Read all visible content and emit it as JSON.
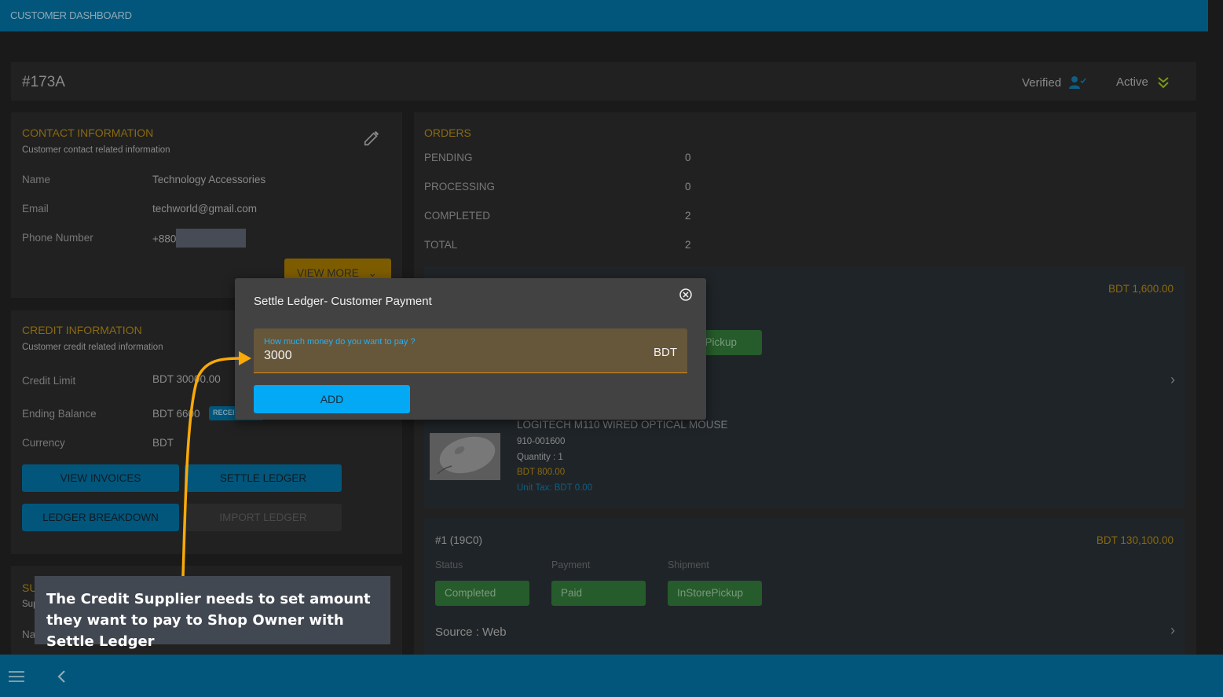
{
  "app": {
    "title": "CUSTOMER DASHBOARD"
  },
  "header": {
    "customer_id": "#173A",
    "verified_label": "Verified",
    "active_label": "Active",
    "colors": {
      "verified_icon": "#0d5f85",
      "active_icon": "#7a9a10"
    }
  },
  "contact": {
    "title": "CONTACT INFORMATION",
    "subtitle": "Customer contact related information",
    "rows": [
      {
        "label": "Name",
        "value": "Technology Accessories"
      },
      {
        "label": "Email",
        "value": "techworld@gmail.com"
      },
      {
        "label": "Phone Number",
        "value": "+880"
      }
    ],
    "view_more_label": "VIEW MORE"
  },
  "credit": {
    "title": "CREDIT INFORMATION",
    "subtitle": "Customer credit related information",
    "rows": [
      {
        "label": "Credit Limit",
        "value": "BDT 30000.00"
      },
      {
        "label": "Ending Balance",
        "value": "BDT 6600",
        "tag": "RECEIPT"
      },
      {
        "label": "Currency",
        "value": "BDT"
      }
    ],
    "buttons": {
      "view_invoices": "VIEW INVOICES",
      "settle_ledger": "SETTLE LEDGER",
      "ledger_breakdown": "LEDGER BREAKDOWN",
      "import_ledger": "IMPORT LEDGER"
    }
  },
  "supplier": {
    "title": "SU",
    "subtitle": "Sup",
    "row_label": "Na"
  },
  "orders": {
    "title": "ORDERS",
    "stats": [
      {
        "label": "PENDING",
        "value": "0"
      },
      {
        "label": "PROCESSING",
        "value": "0"
      },
      {
        "label": "COMPLETED",
        "value": "2"
      },
      {
        "label": "TOTAL",
        "value": "2"
      }
    ],
    "list": [
      {
        "amount": "BDT 1,600.00",
        "shipment_header_partial": "t",
        "shipment_partial": "ePickup",
        "item": {
          "name": "LOGITECH M110 WIRED OPTICAL MOUSE",
          "sku": "910-001600",
          "quantity": "Quantity : 1",
          "price": "BDT 800.00",
          "unit_tax": "Unit Tax: BDT 0.00"
        }
      },
      {
        "id": "#1 (19C0)",
        "amount": "BDT 130,100.00",
        "headers": {
          "status": "Status",
          "payment": "Payment",
          "shipment": "Shipment"
        },
        "status": "Completed",
        "payment": "Paid",
        "shipment": "InStorePickup",
        "source": "Source : Web"
      }
    ]
  },
  "modal": {
    "title": "Settle Ledger- Customer Payment",
    "field_label": "How much money do you want to pay ?",
    "field_value": "3000",
    "field_suffix": "BDT",
    "add_label": "ADD"
  },
  "annotation": {
    "text": "The Credit Supplier needs to set amount they want to pay to Shop Owner with Settle Ledger",
    "arrow_color": "#f9a908"
  }
}
